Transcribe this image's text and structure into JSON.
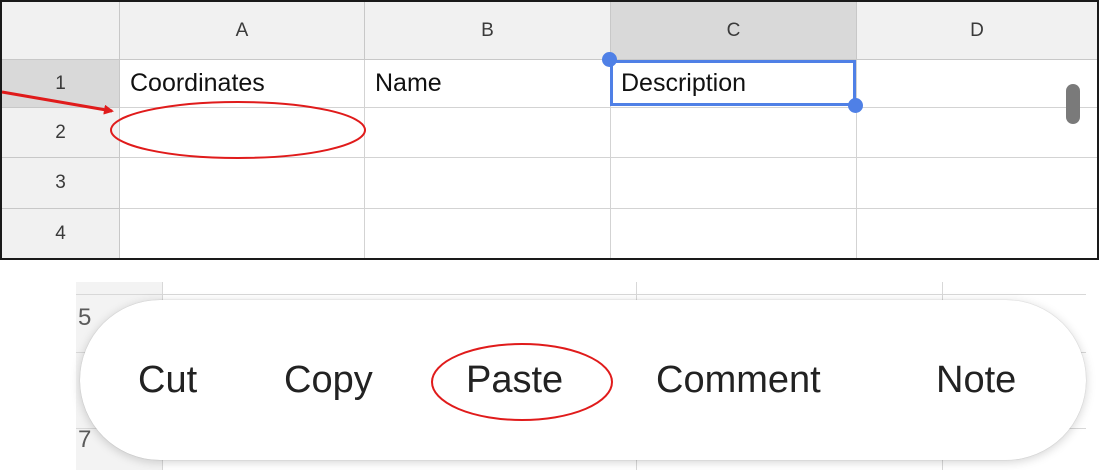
{
  "sheet": {
    "columns": [
      "A",
      "B",
      "C",
      "D"
    ],
    "active_column": "C",
    "rows": [
      "1",
      "2",
      "3",
      "4"
    ],
    "cells": [
      [
        "Coordinates",
        "Name",
        "Description",
        ""
      ],
      [
        "",
        "",
        "",
        ""
      ],
      [
        "",
        "",
        "",
        ""
      ],
      [
        "",
        "",
        "",
        ""
      ]
    ],
    "selected_cell": "C1",
    "selection_color": "#4f80e6"
  },
  "zoom": {
    "rows": [
      "5",
      "",
      "7"
    ]
  },
  "context_menu": {
    "items": [
      "Cut",
      "Copy",
      "Paste",
      "Comment",
      "Note"
    ]
  },
  "annotations": {
    "color": "#e01b1b"
  }
}
